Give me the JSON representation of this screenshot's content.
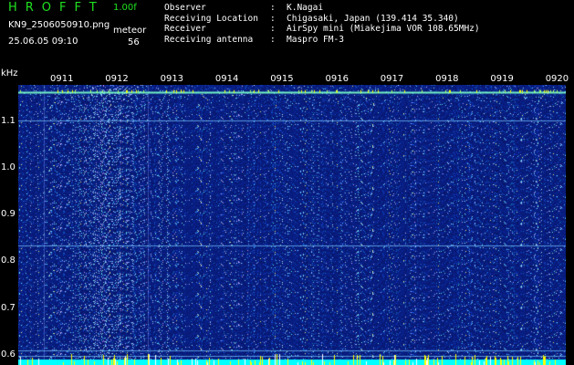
{
  "header": {
    "app_title": "HROFFT",
    "version": "1.00f",
    "file_name": "KN9_2506050910.png",
    "mode": "meteor",
    "timestamp": "25.06.05 09:10",
    "count": "56"
  },
  "station": [
    {
      "key": "Observer",
      "sep": ":",
      "value": "K.Nagai"
    },
    {
      "key": "Receiving Location",
      "sep": ":",
      "value": "Chigasaki, Japan (139.414 35.340)"
    },
    {
      "key": "Receiver",
      "sep": ":",
      "value": "AirSpy mini (Miakejima VOR 108.65MHz)"
    },
    {
      "key": "Receiving antenna",
      "sep": ":",
      "value": "Maspro FM-3"
    }
  ],
  "colors": {
    "background": "#000000",
    "plot_noise": "#0a1a78",
    "title_green": "#20e020",
    "signal_cyan": "#00ffff",
    "marker_yellow": "#ffff00"
  },
  "chart_data": {
    "type": "heatmap",
    "ylabel": "kHz",
    "y_ticks": [
      "1.1",
      "1.0",
      "0.9",
      "0.8",
      "0.7",
      "0.6"
    ],
    "ylim": [
      0.58,
      1.18
    ],
    "x_ticks": [
      "0911",
      "0912",
      "0913",
      "0914",
      "0915",
      "0916",
      "0917",
      "0918",
      "0919",
      "0920"
    ],
    "grid": true,
    "horizontal_lines_khz": [
      1.165,
      1.104,
      0.836,
      0.612,
      0.6
    ],
    "bright_trace_khz": 1.165
  }
}
